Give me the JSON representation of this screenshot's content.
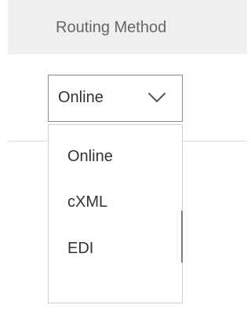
{
  "table": {
    "header": {
      "column_label": "Routing Method"
    }
  },
  "routing_select": {
    "selected_value": "Online",
    "chevron_icon": "chevron-down-icon",
    "options": [
      {
        "label": "Online"
      },
      {
        "label": "cXML"
      },
      {
        "label": "EDI"
      }
    ]
  },
  "colors": {
    "header_background": "#efefef",
    "header_text": "#666666",
    "text": "#333333",
    "select_border": "#8a8a8a",
    "dropdown_border": "#cfcfcf",
    "divider": "#dcdcdc",
    "scrollbar": "#7d7d7d"
  }
}
